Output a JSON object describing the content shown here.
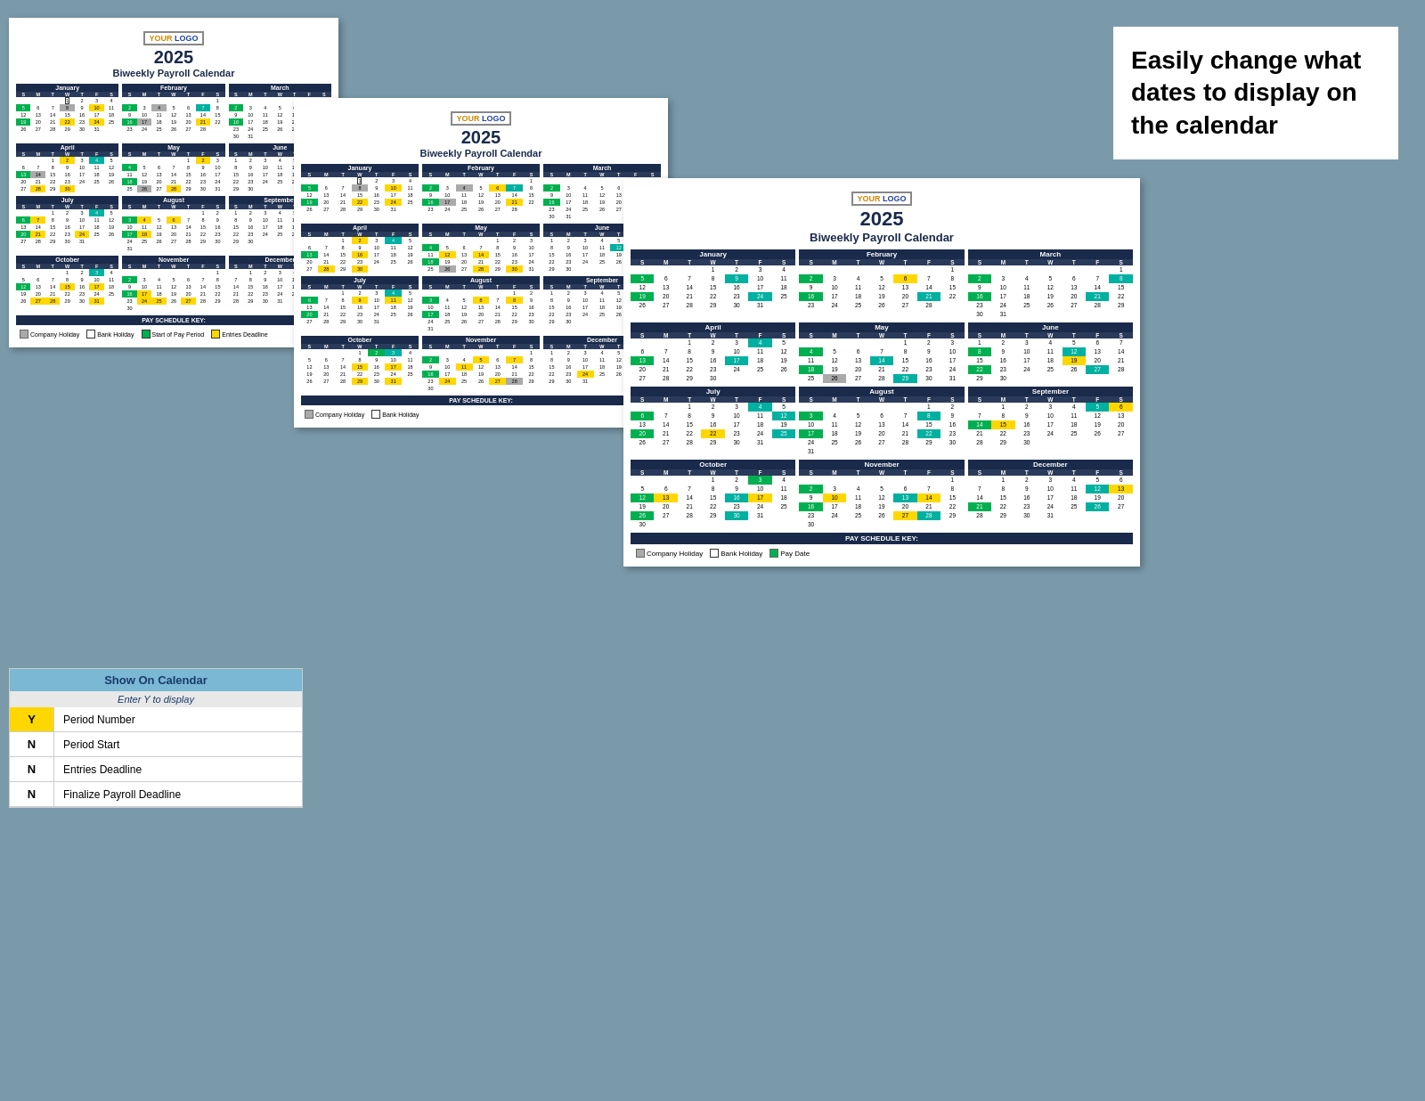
{
  "right_panel": {
    "text": "Easily change what dates to display on the calendar"
  },
  "doc_back": {
    "year": "2025",
    "title": "Biweekly Payroll Calendar",
    "logo": "YOUR LOGO"
  },
  "doc_mid": {
    "year": "2025",
    "title": "Biweekly Payroll Calendar",
    "logo": "YOUR LOGO"
  },
  "doc_front": {
    "year": "2025",
    "title": "Biweekly Payroll Calendar",
    "logo": "YOUR LOGO"
  },
  "show_on_calendar": {
    "header": "Show On Calendar",
    "subtitle": "Enter Y to display",
    "rows": [
      {
        "value": "Y",
        "label": "Period Number",
        "style": "y"
      },
      {
        "value": "N",
        "label": "Period Start",
        "style": "n"
      },
      {
        "value": "N",
        "label": "Entries Deadline",
        "style": "n"
      },
      {
        "value": "N",
        "label": "Finalize Payroll Deadline",
        "style": "n"
      }
    ]
  },
  "months": [
    "January",
    "February",
    "March",
    "April",
    "May",
    "June",
    "July",
    "August",
    "September",
    "October",
    "November",
    "December"
  ],
  "days": [
    "S",
    "M",
    "T",
    "W",
    "T",
    "F",
    "S"
  ],
  "pay_key": {
    "company_holiday": "Company Holiday",
    "bank_holiday": "Bank Holiday",
    "start_of_pay": "Start of Pay Period",
    "entries_deadline": "Entries Deadline",
    "pay_date": "Pay Date"
  }
}
